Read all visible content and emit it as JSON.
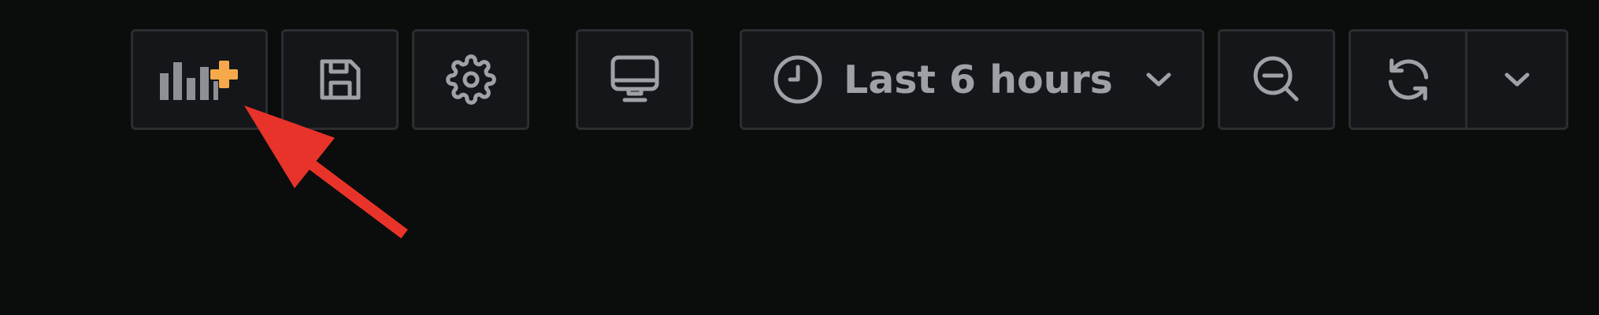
{
  "toolbar": {
    "time_range": {
      "label": "Last 6 hours"
    },
    "icons": {
      "add_panel": "add-panel-icon",
      "save": "save-icon",
      "settings": "gear-icon",
      "view_mode": "monitor-icon",
      "time": "clock-icon",
      "zoom_out": "zoom-out-icon",
      "refresh": "refresh-icon",
      "dropdown": "chevron-down-icon"
    }
  },
  "annotation": {
    "arrow_color": "#e8332a"
  },
  "colors": {
    "background": "#0b0c0c",
    "button_bg": "#141619",
    "button_border": "#2b2d31",
    "icon": "#9fa1a7",
    "accent_orange": "#f5a94a"
  }
}
